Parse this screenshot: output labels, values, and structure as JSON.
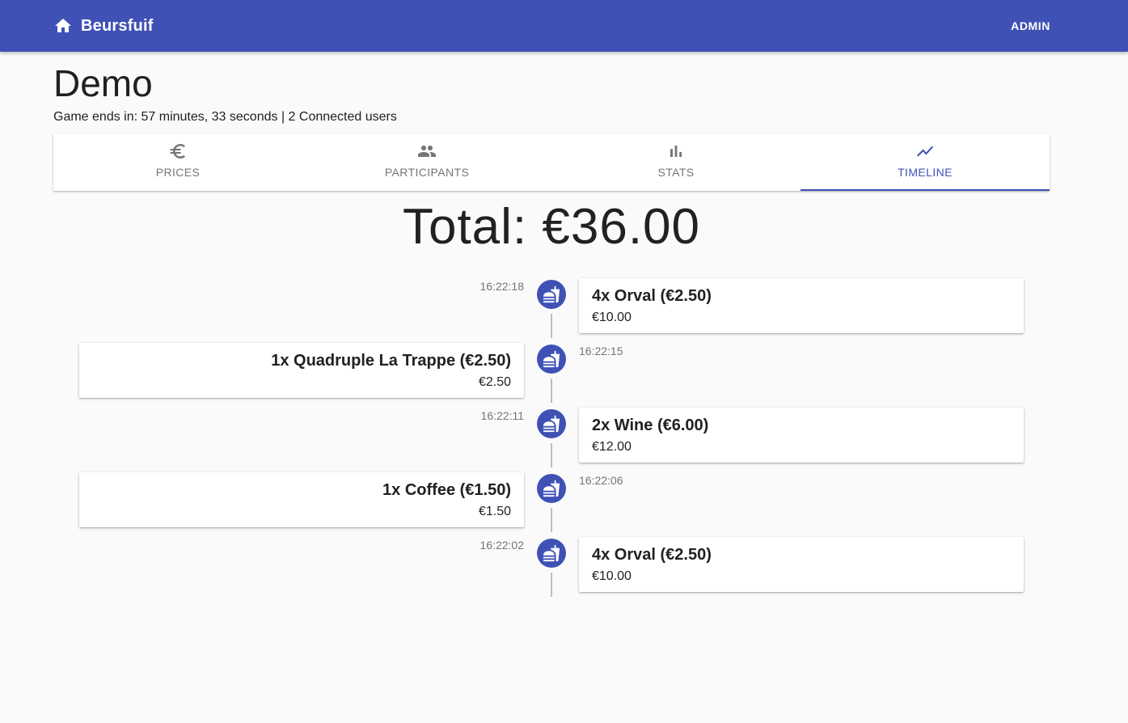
{
  "app": {
    "title": "Beursfuif",
    "admin_label": "ADMIN",
    "accent_color": "#3f51b5",
    "home_icon": "home-icon"
  },
  "game": {
    "title": "Demo",
    "status": "Game ends in: 57 minutes, 33 seconds | 2 Connected users"
  },
  "tabs": [
    {
      "label": "PRICES",
      "icon": "euro-icon",
      "active": false
    },
    {
      "label": "PARTICIPANTS",
      "icon": "people-icon",
      "active": false
    },
    {
      "label": "STATS",
      "icon": "bar-chart-icon",
      "active": false
    },
    {
      "label": "TIMELINE",
      "icon": "timeline-icon",
      "active": true
    }
  ],
  "timeline": {
    "total": "Total: €36.00",
    "entries": [
      {
        "time": "16:22:18",
        "item": "4x Orval (€2.50)",
        "amount": "€10.00",
        "side": "right",
        "icon": "fastfood-icon"
      },
      {
        "time": "16:22:15",
        "item": "1x Quadruple La Trappe (€2.50)",
        "amount": "€2.50",
        "side": "left",
        "icon": "fastfood-icon"
      },
      {
        "time": "16:22:11",
        "item": "2x Wine (€6.00)",
        "amount": "€12.00",
        "side": "right",
        "icon": "fastfood-icon"
      },
      {
        "time": "16:22:06",
        "item": "1x Coffee (€1.50)",
        "amount": "€1.50",
        "side": "left",
        "icon": "fastfood-icon"
      },
      {
        "time": "16:22:02",
        "item": "4x Orval (€2.50)",
        "amount": "€10.00",
        "side": "right",
        "icon": "fastfood-icon"
      }
    ]
  }
}
